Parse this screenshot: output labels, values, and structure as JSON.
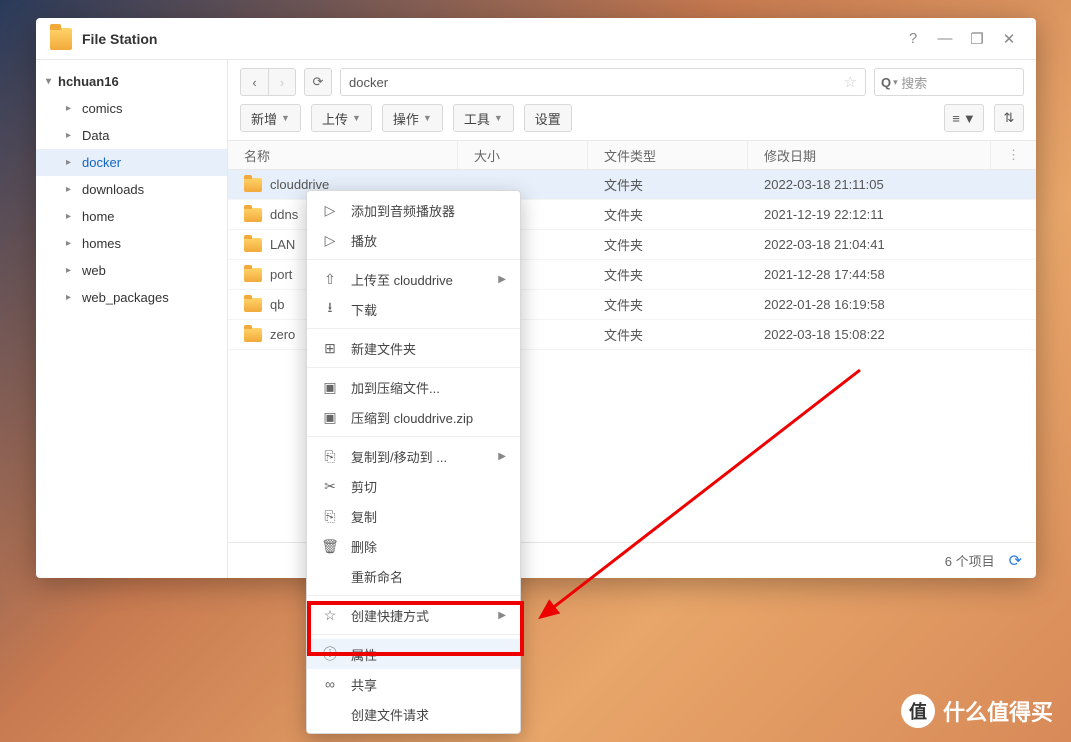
{
  "app": {
    "title": "File Station"
  },
  "winbtns": {
    "help": "?",
    "min": "—",
    "max": "❐",
    "close": "✕"
  },
  "sidebar": {
    "root": "hchuan16",
    "items": [
      {
        "label": "comics"
      },
      {
        "label": "Data"
      },
      {
        "label": "docker"
      },
      {
        "label": "downloads"
      },
      {
        "label": "home"
      },
      {
        "label": "homes"
      },
      {
        "label": "web"
      },
      {
        "label": "web_packages"
      }
    ],
    "selected_index": 2
  },
  "path": "docker",
  "search_placeholder": "搜索",
  "toolbar": {
    "new": "新增",
    "upload": "上传",
    "action": "操作",
    "tool": "工具",
    "settings": "设置"
  },
  "columns": {
    "name": "名称",
    "size": "大小",
    "type": "文件类型",
    "date": "修改日期"
  },
  "rows": [
    {
      "name": "clouddrive",
      "size": "",
      "type": "文件夹",
      "date": "2022-03-18 21:11:05",
      "sel": true
    },
    {
      "name": "ddns",
      "size": "",
      "type": "文件夹",
      "date": "2021-12-19 22:12:11"
    },
    {
      "name": "LAN",
      "size": "",
      "type": "文件夹",
      "date": "2022-03-18 21:04:41"
    },
    {
      "name": "port",
      "size": "",
      "type": "文件夹",
      "date": "2021-12-28 17:44:58"
    },
    {
      "name": "qb",
      "size": "",
      "type": "文件夹",
      "date": "2022-01-28 16:19:58"
    },
    {
      "name": "zero",
      "size": "",
      "type": "文件夹",
      "date": "2022-03-18 15:08:22"
    }
  ],
  "status": {
    "count": "6 个项目"
  },
  "ctx": {
    "add_player": "添加到音频播放器",
    "play": "播放",
    "upload_to": "上传至 clouddrive",
    "download": "下载",
    "new_folder": "新建文件夹",
    "add_archive": "加到压缩文件...",
    "compress_to": "压缩到 clouddrive.zip",
    "copy_move": "复制到/移动到 ...",
    "cut": "剪切",
    "copy": "复制",
    "delete": "删除",
    "rename": "重新命名",
    "shortcut": "创建快捷方式",
    "properties": "属性",
    "share": "共享",
    "file_request": "创建文件请求"
  },
  "watermark": "什么值得买",
  "watermark_badge": "值"
}
